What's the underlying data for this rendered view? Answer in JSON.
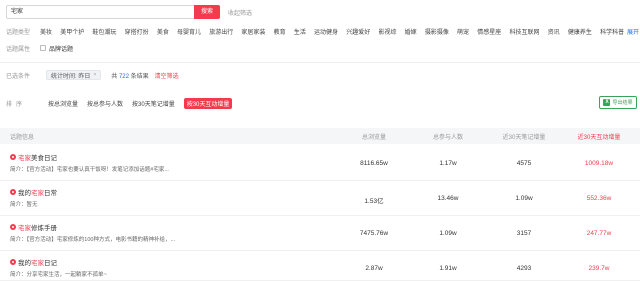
{
  "search": {
    "value": "宅家",
    "button": "搜索",
    "collapse": "收起筛选"
  },
  "topic_type": {
    "label": "话题类型",
    "categories": [
      "美妆",
      "美甲个护",
      "鞋包潮玩",
      "穿搭打扮",
      "美食",
      "母婴育儿",
      "旅游出行",
      "家居家装",
      "教育",
      "生活",
      "运动健身",
      "兴趣爱好",
      "影视综",
      "婚嫁",
      "摄影摄像",
      "萌宠",
      "情感星座",
      "科技互联网",
      "资讯",
      "健康养生",
      "科学科普"
    ],
    "expand": "展开"
  },
  "topic_attr": {
    "label": "话题属性",
    "option": "品牌话题"
  },
  "selected": {
    "label": "已选条件",
    "tag": "统计时间: 昨日",
    "tag_close": "×",
    "count_prefix": "共",
    "count": "722",
    "count_suffix": "条结果",
    "clear": "清空筛选"
  },
  "sort": {
    "label": "排序",
    "options": [
      "按总浏览量",
      "按总参与人数",
      "按30天笔记增量",
      "按30天互动增量"
    ],
    "active_index": 3,
    "export": "导出结果",
    "export_icon": "excel-icon"
  },
  "table": {
    "headers": [
      "话题信息",
      "总浏览量",
      "总参与人数",
      "近30天笔记增量",
      "近30天互动增量"
    ],
    "intro_prefix": "简介：",
    "rows": [
      {
        "title_kw": "宅家",
        "title_rest": "美食日记",
        "title_pre": "",
        "intro": "【官方活动】宅家也要认真干饭呀！发笔记添加话题#宅家...",
        "views": "8116.65w",
        "participants": "1.17w",
        "notes_30d": "4575",
        "interact_30d": "1009.18w"
      },
      {
        "title_kw": "宅家",
        "title_rest": "日常",
        "title_pre": "我的",
        "intro": "暂无",
        "views": "1.53亿",
        "participants": "13.46w",
        "notes_30d": "1.09w",
        "interact_30d": "552.36w"
      },
      {
        "title_kw": "宅家",
        "title_rest": "修炼手册",
        "title_pre": "",
        "intro": "【官方活动】宅家修炼的100种方式，电影书籍的精神补给，...",
        "views": "7475.76w",
        "participants": "1.09w",
        "notes_30d": "3157",
        "interact_30d": "247.77w"
      },
      {
        "title_kw": "宅家",
        "title_rest": "日记",
        "title_pre": "我的",
        "intro": "分享宅家生活，一起躺家不孤单~",
        "views": "2.87w",
        "participants": "1.91w",
        "notes_30d": "4293",
        "interact_30d": "239.7w"
      }
    ]
  }
}
